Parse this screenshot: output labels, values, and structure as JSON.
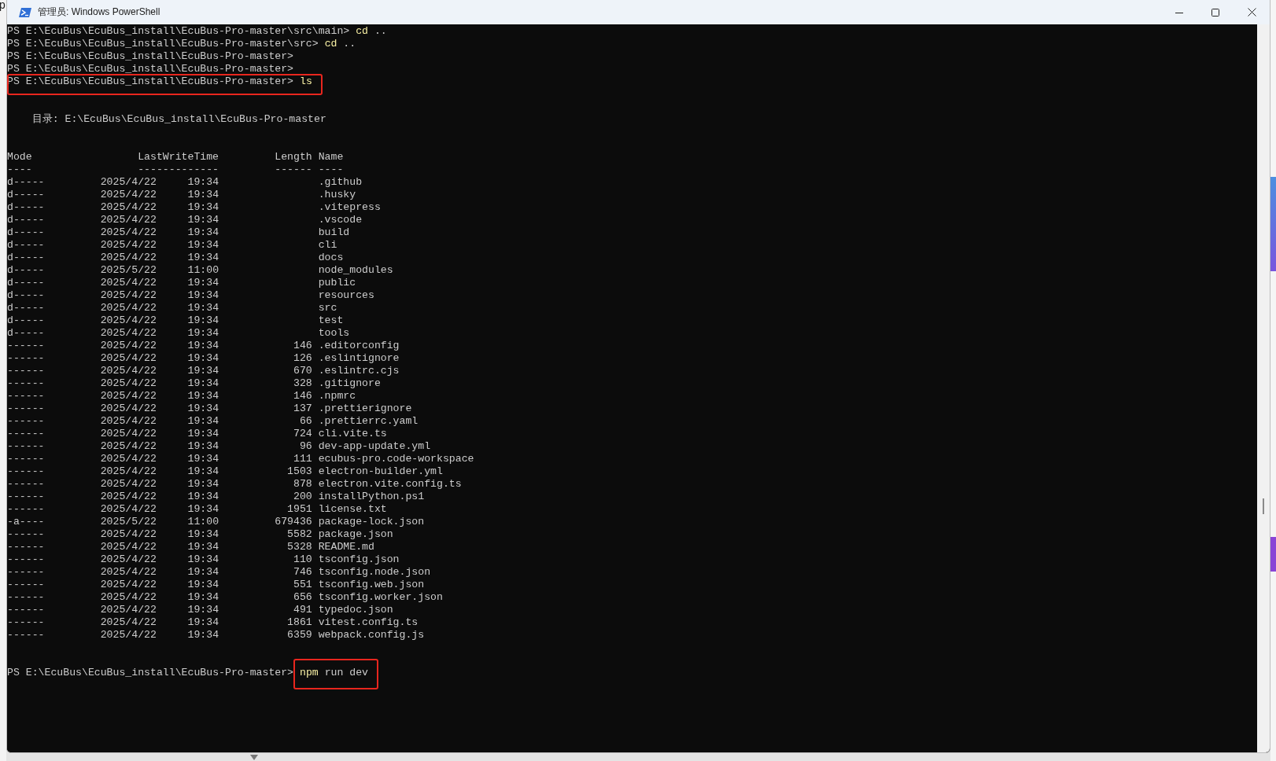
{
  "background_text": "p",
  "window": {
    "title": "管理员: Windows PowerShell"
  },
  "console": {
    "blocks": [
      {
        "kind": "prompt",
        "prompt": "PS E:\\EcuBus\\EcuBus_install\\EcuBus-Pro-master\\src\\main>",
        "command": "cd",
        "args": ".."
      },
      {
        "kind": "prompt",
        "prompt": "PS E:\\EcuBus\\EcuBus_install\\EcuBus-Pro-master\\src>",
        "command": "cd",
        "args": ".."
      },
      {
        "kind": "prompt",
        "prompt": "PS E:\\EcuBus\\EcuBus_install\\EcuBus-Pro-master>"
      },
      {
        "kind": "prompt",
        "prompt": "PS E:\\EcuBus\\EcuBus_install\\EcuBus-Pro-master>"
      },
      {
        "kind": "prompt",
        "prompt": "PS E:\\EcuBus\\EcuBus_install\\EcuBus-Pro-master>",
        "command": "ls",
        "prompt_highlighted": true,
        "command_highlighted": true
      },
      {
        "kind": "blank"
      },
      {
        "kind": "blank"
      },
      {
        "kind": "directory",
        "text": "目录: E:\\EcuBus\\EcuBus_install\\EcuBus-Pro-master"
      },
      {
        "kind": "blank"
      },
      {
        "kind": "blank"
      },
      {
        "kind": "listing",
        "columns": [
          "Mode",
          "LastWriteTime",
          "Length",
          "Name"
        ],
        "rules": [
          "----",
          "-------------",
          "------",
          "----"
        ],
        "rows": [
          {
            "mode": "d-----",
            "date": "2025/4/22",
            "time": "19:34",
            "name": ".github"
          },
          {
            "mode": "d-----",
            "date": "2025/4/22",
            "time": "19:34",
            "name": ".husky"
          },
          {
            "mode": "d-----",
            "date": "2025/4/22",
            "time": "19:34",
            "name": ".vitepress"
          },
          {
            "mode": "d-----",
            "date": "2025/4/22",
            "time": "19:34",
            "name": ".vscode"
          },
          {
            "mode": "d-----",
            "date": "2025/4/22",
            "time": "19:34",
            "name": "build"
          },
          {
            "mode": "d-----",
            "date": "2025/4/22",
            "time": "19:34",
            "name": "cli"
          },
          {
            "mode": "d-----",
            "date": "2025/4/22",
            "time": "19:34",
            "name": "docs"
          },
          {
            "mode": "d-----",
            "date": "2025/5/22",
            "time": "11:00",
            "name": "node_modules"
          },
          {
            "mode": "d-----",
            "date": "2025/4/22",
            "time": "19:34",
            "name": "public"
          },
          {
            "mode": "d-----",
            "date": "2025/4/22",
            "time": "19:34",
            "name": "resources"
          },
          {
            "mode": "d-----",
            "date": "2025/4/22",
            "time": "19:34",
            "name": "src"
          },
          {
            "mode": "d-----",
            "date": "2025/4/22",
            "time": "19:34",
            "name": "test"
          },
          {
            "mode": "d-----",
            "date": "2025/4/22",
            "time": "19:34",
            "name": "tools"
          },
          {
            "mode": "------",
            "date": "2025/4/22",
            "time": "19:34",
            "length": "146",
            "name": ".editorconfig"
          },
          {
            "mode": "------",
            "date": "2025/4/22",
            "time": "19:34",
            "length": "126",
            "name": ".eslintignore"
          },
          {
            "mode": "------",
            "date": "2025/4/22",
            "time": "19:34",
            "length": "670",
            "name": ".eslintrc.cjs"
          },
          {
            "mode": "------",
            "date": "2025/4/22",
            "time": "19:34",
            "length": "328",
            "name": ".gitignore"
          },
          {
            "mode": "------",
            "date": "2025/4/22",
            "time": "19:34",
            "length": "146",
            "name": ".npmrc"
          },
          {
            "mode": "------",
            "date": "2025/4/22",
            "time": "19:34",
            "length": "137",
            "name": ".prettierignore"
          },
          {
            "mode": "------",
            "date": "2025/4/22",
            "time": "19:34",
            "length": "66",
            "name": ".prettierrc.yaml"
          },
          {
            "mode": "------",
            "date": "2025/4/22",
            "time": "19:34",
            "length": "724",
            "name": "cli.vite.ts"
          },
          {
            "mode": "------",
            "date": "2025/4/22",
            "time": "19:34",
            "length": "96",
            "name": "dev-app-update.yml"
          },
          {
            "mode": "------",
            "date": "2025/4/22",
            "time": "19:34",
            "length": "111",
            "name": "ecubus-pro.code-workspace"
          },
          {
            "mode": "------",
            "date": "2025/4/22",
            "time": "19:34",
            "length": "1503",
            "name": "electron-builder.yml"
          },
          {
            "mode": "------",
            "date": "2025/4/22",
            "time": "19:34",
            "length": "878",
            "name": "electron.vite.config.ts"
          },
          {
            "mode": "------",
            "date": "2025/4/22",
            "time": "19:34",
            "length": "200",
            "name": "installPython.ps1"
          },
          {
            "mode": "------",
            "date": "2025/4/22",
            "time": "19:34",
            "length": "1951",
            "name": "license.txt"
          },
          {
            "mode": "-a----",
            "date": "2025/5/22",
            "time": "11:00",
            "length": "679436",
            "name": "package-lock.json"
          },
          {
            "mode": "------",
            "date": "2025/4/22",
            "time": "19:34",
            "length": "5582",
            "name": "package.json"
          },
          {
            "mode": "------",
            "date": "2025/4/22",
            "time": "19:34",
            "length": "5328",
            "name": "README.md"
          },
          {
            "mode": "------",
            "date": "2025/4/22",
            "time": "19:34",
            "length": "110",
            "name": "tsconfig.json"
          },
          {
            "mode": "------",
            "date": "2025/4/22",
            "time": "19:34",
            "length": "746",
            "name": "tsconfig.node.json"
          },
          {
            "mode": "------",
            "date": "2025/4/22",
            "time": "19:34",
            "length": "551",
            "name": "tsconfig.web.json"
          },
          {
            "mode": "------",
            "date": "2025/4/22",
            "time": "19:34",
            "length": "656",
            "name": "tsconfig.worker.json"
          },
          {
            "mode": "------",
            "date": "2025/4/22",
            "time": "19:34",
            "length": "491",
            "name": "typedoc.json"
          },
          {
            "mode": "------",
            "date": "2025/4/22",
            "time": "19:34",
            "length": "1861",
            "name": "vitest.config.ts"
          },
          {
            "mode": "------",
            "date": "2025/4/22",
            "time": "19:34",
            "length": "6359",
            "name": "webpack.config.js"
          }
        ]
      },
      {
        "kind": "blank"
      },
      {
        "kind": "blank"
      },
      {
        "kind": "prompt",
        "prompt": "PS E:\\EcuBus\\EcuBus_install\\EcuBus-Pro-master>",
        "command": "npm",
        "args": "run dev",
        "prompt_highlighted": false,
        "command_highlighted": true
      }
    ]
  }
}
